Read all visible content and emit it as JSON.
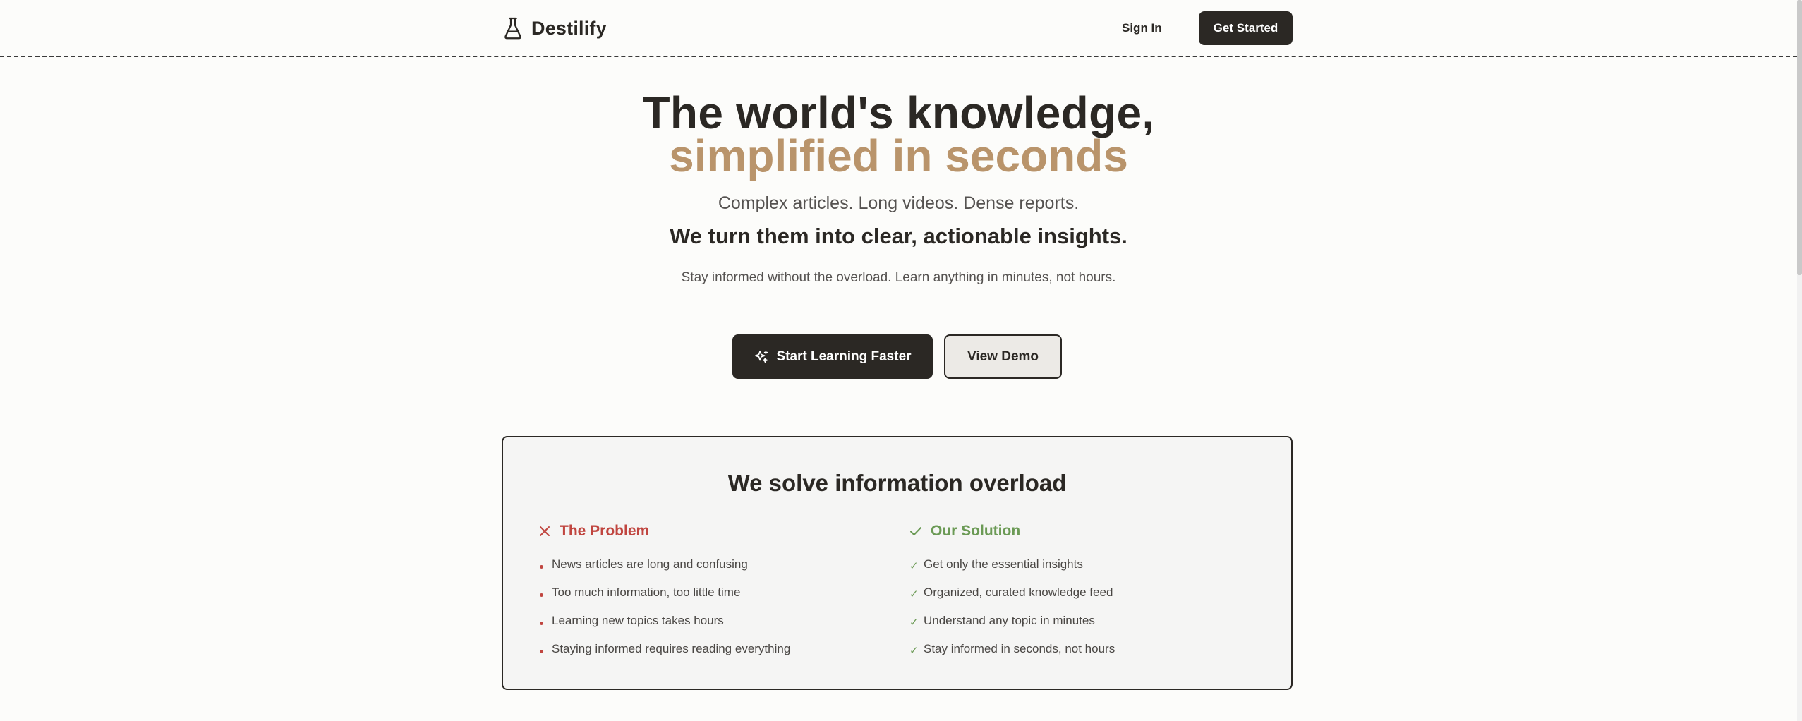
{
  "header": {
    "brand_name": "Destilify",
    "sign_in_label": "Sign In",
    "get_started_label": "Get Started"
  },
  "hero": {
    "title_line1": "The world's knowledge,",
    "title_line2": "simplified in seconds",
    "subtitle": "Complex articles. Long videos. Dense reports.",
    "tagline": "We turn them into clear, actionable insights.",
    "description": "Stay informed without the overload. Learn anything in minutes, not hours.",
    "primary_cta_label": "Start Learning Faster",
    "secondary_cta_label": "View Demo"
  },
  "comparison": {
    "title": "We solve information overload",
    "problem": {
      "heading": "The Problem",
      "items": [
        "News articles are long and confusing",
        "Too much information, too little time",
        "Learning new topics takes hours",
        "Staying informed requires reading everything"
      ]
    },
    "solution": {
      "heading": "Our Solution",
      "items": [
        "Get only the essential insights",
        "Organized, curated knowledge feed",
        "Understand any topic in minutes",
        "Stay informed in seconds, not hours"
      ]
    }
  },
  "icons": {
    "brand": "flask-icon",
    "primary_cta": "sparkles-icon",
    "problem": "x-icon",
    "solution": "check-icon"
  },
  "colors": {
    "primary": "#2b2824",
    "accent": "#b9946b",
    "problem": "#c0453f",
    "solution": "#6b9a55",
    "background": "#fcfcfa"
  }
}
